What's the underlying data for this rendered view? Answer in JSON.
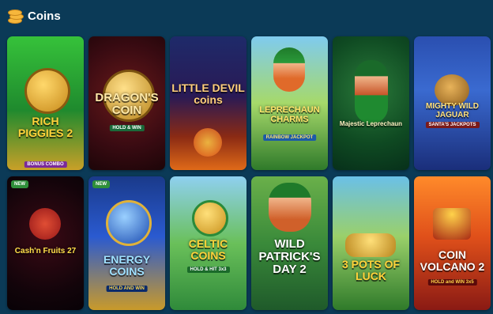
{
  "section": {
    "title": "Coins",
    "icon": "coins-icon"
  },
  "games": [
    {
      "title": "RICH PIGGIES 2",
      "subtitle": "BONUS COMBO",
      "badge": ""
    },
    {
      "title": "DRAGON'S COIN",
      "subtitle": "HOLD & WIN",
      "badge": ""
    },
    {
      "title": "LITTLE DEVIL coins",
      "subtitle": "",
      "badge": ""
    },
    {
      "title": "LEPRECHAUN CHARMS",
      "subtitle": "RAINBOW JACKPOT",
      "badge": ""
    },
    {
      "title": "Majestic Leprechaun",
      "subtitle": "",
      "badge": ""
    },
    {
      "title": "MIGHTY WILD JAGUAR",
      "subtitle": "SANTA'S JACKPOTS",
      "badge": ""
    },
    {
      "title": "Cash'n Fruits 27",
      "subtitle": "",
      "badge": "NEW"
    },
    {
      "title": "ENERGY COINS",
      "subtitle": "HOLD AND WIN",
      "badge": "NEW"
    },
    {
      "title": "CELTIC COINS",
      "subtitle": "HOLD & HIT 3x3",
      "badge": ""
    },
    {
      "title": "WILD PATRICK'S DAY 2",
      "subtitle": "",
      "badge": ""
    },
    {
      "title": "3 POTS OF LUCK",
      "subtitle": "",
      "badge": ""
    },
    {
      "title": "COIN VOLCANO 2",
      "subtitle": "HOLD and WIN 3x5",
      "badge": ""
    }
  ]
}
